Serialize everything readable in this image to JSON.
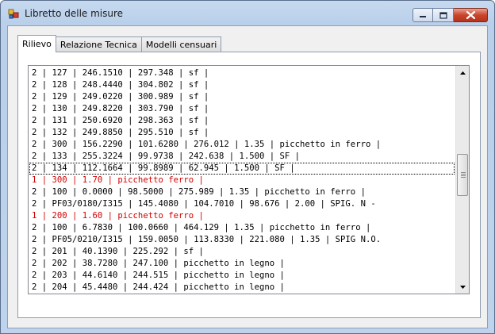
{
  "window": {
    "title": "Libretto delle misure",
    "icon": "app-icon"
  },
  "caption_buttons": {
    "minimize_icon": "minimize-icon",
    "maximize_icon": "maximize-icon",
    "close_icon": "close-icon"
  },
  "tabs": [
    {
      "label": "Rilievo",
      "active": true
    },
    {
      "label": "Relazione Tecnica",
      "active": false
    },
    {
      "label": "Modelli censuari",
      "active": false
    }
  ],
  "lines": [
    {
      "text": "2 | 127 | 246.1510 | 297.348 | sf |",
      "style": "normal"
    },
    {
      "text": "2 | 128 | 248.4440 | 304.802 | sf |",
      "style": "normal"
    },
    {
      "text": "2 | 129 | 249.0220 | 300.989 | sf |",
      "style": "normal"
    },
    {
      "text": "2 | 130 | 249.8220 | 303.790 | sf |",
      "style": "normal"
    },
    {
      "text": "2 | 131 | 250.6920 | 298.363 | sf |",
      "style": "normal"
    },
    {
      "text": "2 | 132 | 249.8850 | 295.510 | sf |",
      "style": "normal"
    },
    {
      "text": "2 | 300 | 156.2290 | 101.6280 | 276.012 | 1.35 | picchetto in ferro |",
      "style": "normal"
    },
    {
      "text": "2 | 133 | 255.3224 | 99.9738 | 242.638 | 1.500 | SF |",
      "style": "normal"
    },
    {
      "text": "2 | 134 | 112.1664 | 99.8989 | 62.945 | 1.500 | SF |",
      "style": "selected"
    },
    {
      "text": "1 | 300 | 1.70 | picchetto ferro |",
      "style": "red"
    },
    {
      "text": "2 | 100 | 0.0000 | 98.5000 | 275.989 | 1.35 | picchetto in ferro |",
      "style": "normal"
    },
    {
      "text": "2 | PF03/0180/I315 | 145.4080 | 104.7010 | 98.676 | 2.00 | SPIG. N -",
      "style": "normal"
    },
    {
      "text": "1 | 200 | 1.60 | picchetto ferro |",
      "style": "red"
    },
    {
      "text": "2 | 100 | 6.7830 | 100.0660 | 464.129 | 1.35 | picchetto in ferro |",
      "style": "normal"
    },
    {
      "text": "2 | PF05/0210/I315 | 159.0050 | 113.8330 | 221.080 | 1.35 | SPIG N.O.",
      "style": "normal"
    },
    {
      "text": "2 | 201 | 40.1390 | 225.292 | sf |",
      "style": "normal"
    },
    {
      "text": "2 | 202 | 38.7280 | 247.100 | picchetto in legno |",
      "style": "normal"
    },
    {
      "text": "2 | 203 | 44.6140 | 244.515 | picchetto in legno |",
      "style": "normal"
    },
    {
      "text": "2 | 204 | 45.4480 | 244.424 | picchetto in legno |",
      "style": "normal"
    }
  ],
  "scrollbar": {
    "up_icon": "scroll-up-arrow-icon",
    "down_icon": "scroll-down-arrow-icon"
  },
  "colors": {
    "red_text": "#d10000",
    "window_frame": "#bfd3ec",
    "close_button": "#c9452c"
  }
}
